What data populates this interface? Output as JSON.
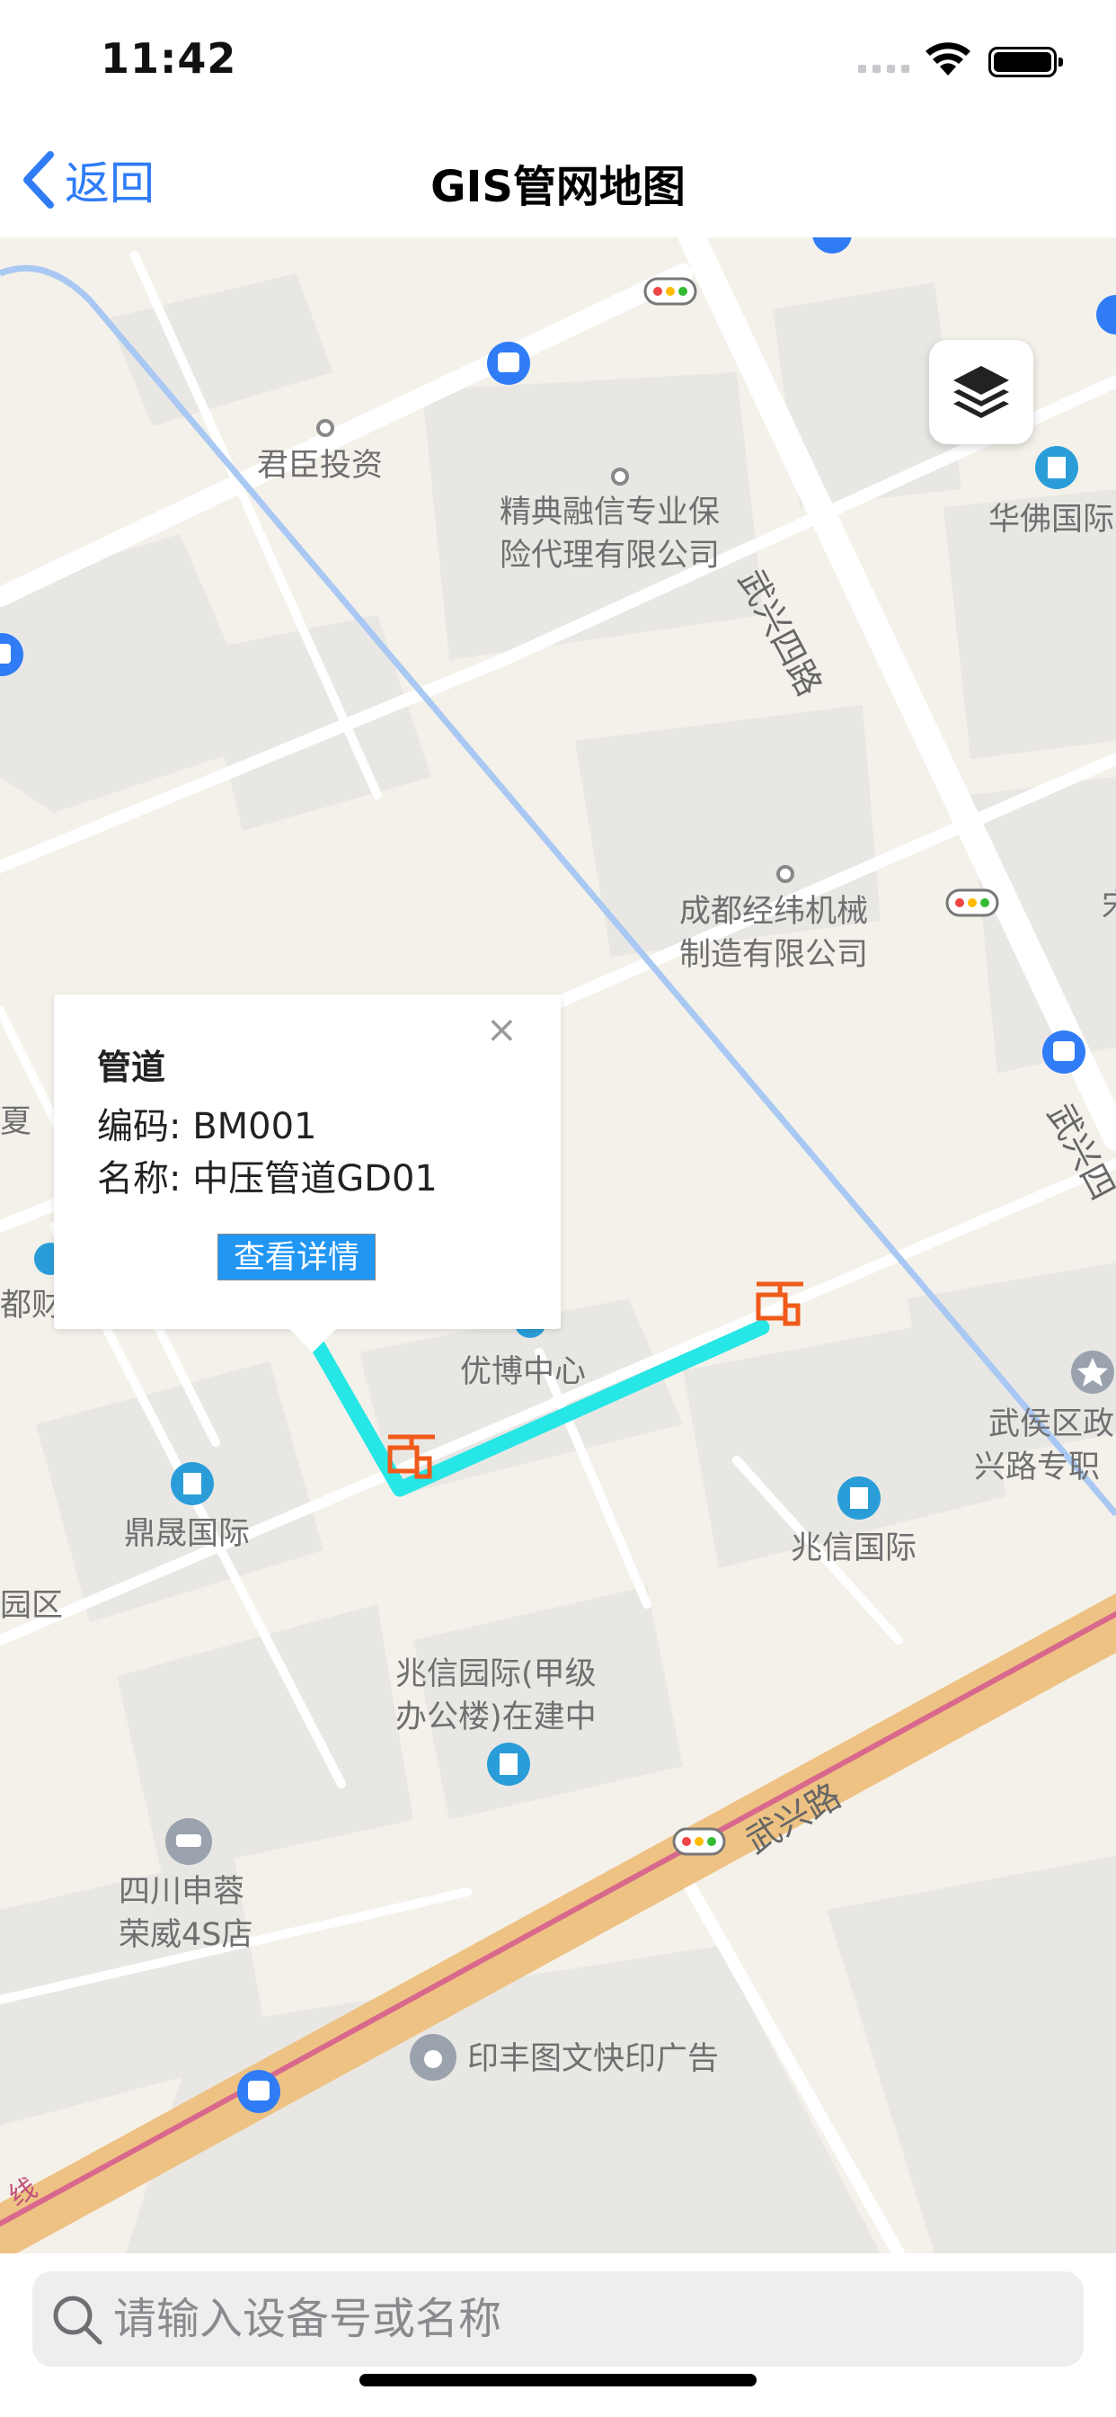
{
  "status_bar": {
    "time": "11:42"
  },
  "nav": {
    "back_label": "返回",
    "title": "GIS管网地图"
  },
  "map": {
    "poi_labels": {
      "junchen": "君臣投资",
      "jingdian_1": "精典融信专业保",
      "jingdian_2": "险代理有限公司",
      "huafo": "华佛国际",
      "chengdu_1": "成都经纬机械",
      "chengdu_2": "制造有限公司",
      "youbo": "优博中心",
      "dingsheng": "鼎晟国际",
      "zhaoxin": "兆信国际",
      "wuhou_1": "武侯区政",
      "wuhou_2": "兴路专职",
      "zhaoxin_yuan_1": "兆信园际(甲级",
      "zhaoxin_yuan_2": "办公楼)在建中",
      "sichuan_1": "四川申蓉",
      "sichuan_2": "荣威4S店",
      "yinfeng": "印丰图文快印广告",
      "edge_xia": "夏",
      "edge_dou": "都财",
      "edge_yuan": "园区",
      "edge_song": "宋"
    },
    "road_labels": {
      "wuxing_si_1": "武兴四路",
      "wuxing_si_2": "武兴四",
      "wuxing": "武兴路",
      "line": "线"
    },
    "pipeline_color": "#27e6e6",
    "valve_color": "#f05a1a"
  },
  "popup": {
    "title": "管道",
    "code_line": "编码: BM001",
    "name_line": "名称: 中压管道GD01",
    "detail_button": "查看详情",
    "close": "×"
  },
  "search": {
    "placeholder": "请输入设备号或名称"
  },
  "icons": [
    "back-chevron-icon",
    "wifi-icon",
    "battery-icon",
    "layers-icon",
    "search-icon",
    "bus-stop-icon",
    "traffic-light-icon",
    "building-icon",
    "car-service-icon",
    "camera-icon",
    "valve-icon",
    "close-icon"
  ]
}
